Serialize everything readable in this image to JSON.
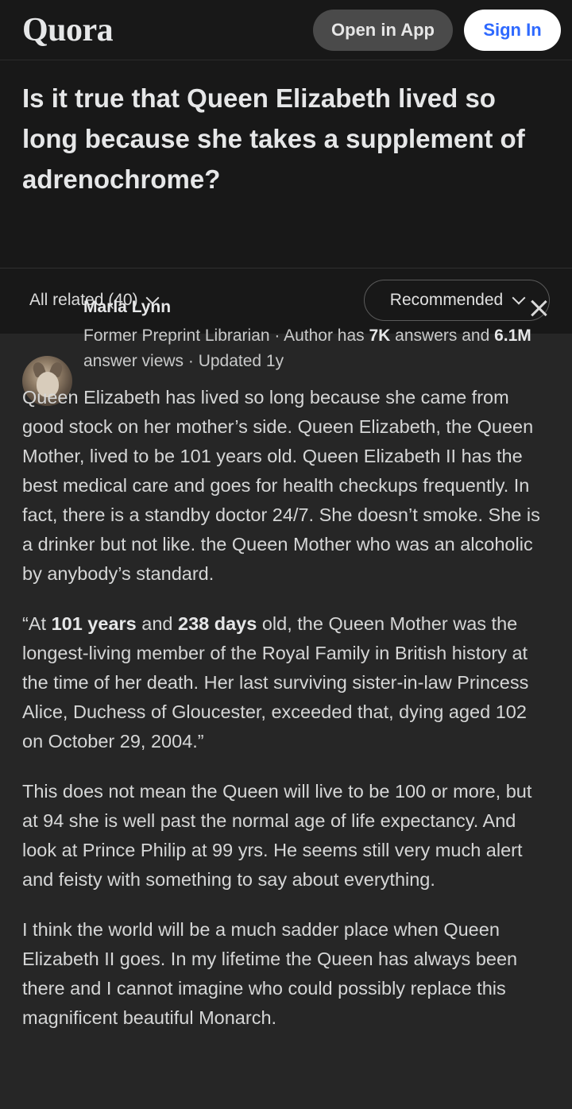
{
  "header": {
    "logo": "Quora",
    "open_in_app": "Open in App",
    "sign_in": "Sign In"
  },
  "question": {
    "title": "Is it true that Queen Elizabeth lived so long because she takes a supplement of adrenochrome?"
  },
  "filters": {
    "all_related": "All related (40)",
    "sort": "Recommended"
  },
  "answer": {
    "author": "Marla Lynn",
    "credential": {
      "prefix": "Former Preprint Librarian · Author has ",
      "answers_count": "7K",
      "mid": " answers and ",
      "views_count": "6.1M",
      "suffix": " answer views · Updated 1y"
    },
    "p1": "Queen Elizabeth has lived so long because she came from good stock on her mother’s side. Queen Elizabeth, the Queen Mother, lived to be 101 years old. Queen Elizabeth II has the best medical care and goes for health checkups frequently. In fact, there is a standby doctor 24/7. She doesn’t smoke. She is a drinker but not like. the Queen Mother who was an alcoholic by anybody’s standard.",
    "p2": {
      "a": "“At ",
      "b": "101 years",
      "c": " and ",
      "d": "238 days",
      "e": " old, the Queen Mother was the longest-living member of the Royal Family in British history at the time of her death. Her last surviving sister-in-law Princess Alice, Duchess of Gloucester, exceeded that, dying aged 102 on October 29, 2004.”"
    },
    "p3": "This does not mean the Queen will live to be 100 or more, but at 94 she is well past the normal age of life expectancy. And look at Prince Philip at 99 yrs. He seems still very much alert and feisty with something to say about everything.",
    "p4": "I think the world will be a much sadder place when Queen Elizabeth II goes. In my lifetime the Queen has always been there and I cannot imagine who could possibly replace this magnificent beautiful Monarch."
  }
}
